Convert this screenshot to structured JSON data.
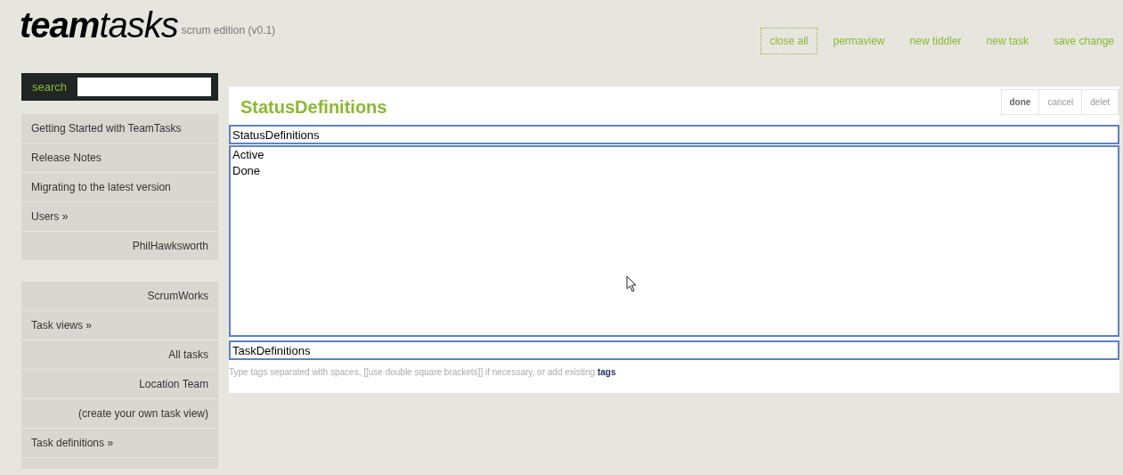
{
  "header": {
    "logo_bold": "team",
    "logo_light": "tasks",
    "subtitle": "scrum edition (v0.1)"
  },
  "top_menu": [
    {
      "label": "close all",
      "focused": true
    },
    {
      "label": "permaview",
      "focused": false
    },
    {
      "label": "new tiddler",
      "focused": false
    },
    {
      "label": "new task",
      "focused": false
    },
    {
      "label": "save change",
      "focused": false
    }
  ],
  "search": {
    "label": "search"
  },
  "sidebar": {
    "groups": [
      {
        "items": [
          {
            "label": "Getting Started with TeamTasks",
            "kind": "left"
          },
          {
            "label": "Release Notes",
            "kind": "left"
          },
          {
            "label": "Migrating to the latest version",
            "kind": "left"
          },
          {
            "label": "Users »",
            "kind": "left"
          },
          {
            "label": "PhilHawksworth",
            "kind": "right"
          }
        ]
      },
      {
        "items": [
          {
            "label": "ScrumWorks",
            "kind": "right"
          },
          {
            "label": "Task views »",
            "kind": "left"
          },
          {
            "label": "All tasks",
            "kind": "right"
          },
          {
            "label": "Location Team",
            "kind": "right"
          },
          {
            "label": "(create your own task view)",
            "kind": "right"
          },
          {
            "label": "Task definitions »",
            "kind": "left"
          },
          {
            "kind": "cut"
          }
        ]
      }
    ]
  },
  "editor": {
    "toolbar": [
      {
        "label": "done",
        "primary": true
      },
      {
        "label": "cancel",
        "primary": false
      },
      {
        "label": "delet",
        "primary": false
      }
    ],
    "title": "StatusDefinitions",
    "title_field": "StatusDefinitions",
    "body": "Active\nDone",
    "tags_field": "TaskDefinitions",
    "hint": "Type tags separated with spaces, [[use double square brackets]] if necessary, or add existing",
    "hint_link": "tags"
  }
}
